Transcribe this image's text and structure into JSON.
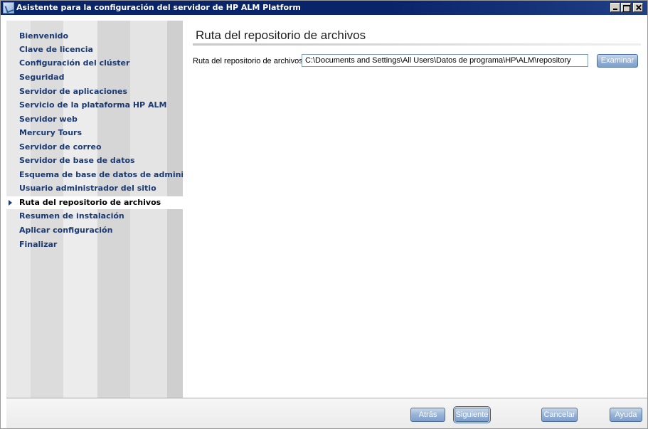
{
  "window": {
    "title": "Asistente para la configuración del servidor de HP ALM Platform"
  },
  "sidebar": {
    "items": [
      {
        "label": "Bienvenido"
      },
      {
        "label": "Clave de licencia"
      },
      {
        "label": "Configuración del clúster"
      },
      {
        "label": "Seguridad"
      },
      {
        "label": "Servidor de aplicaciones"
      },
      {
        "label": "Servicio de la plataforma HP ALM"
      },
      {
        "label": "Servidor web"
      },
      {
        "label": "Mercury Tours"
      },
      {
        "label": "Servidor de correo"
      },
      {
        "label": "Servidor de base de datos"
      },
      {
        "label": "Esquema de base de datos de administrac"
      },
      {
        "label": "Usuario administrador del sitio"
      },
      {
        "label": "Ruta del repositorio de archivos"
      },
      {
        "label": "Resumen de instalación"
      },
      {
        "label": "Aplicar configuración"
      },
      {
        "label": "Finalizar"
      }
    ],
    "active_item": "Ruta del repositorio de archivos"
  },
  "main": {
    "title": "Ruta del repositorio de archivos",
    "repository_label": "Ruta del repositorio de archivos:",
    "repository_path": "C:\\Documents and Settings\\All Users\\Datos de programa\\HP\\ALM\\repository",
    "browse_label": "Examinar"
  },
  "footer": {
    "back_label": "Atrás",
    "next_label": "Siguiente",
    "cancel_label": "Cancelar",
    "help_label": "Ayuda"
  },
  "colors": {
    "titlebar": "#0a246a",
    "nav_text": "#1b3a73",
    "button": "#97b3d6"
  }
}
